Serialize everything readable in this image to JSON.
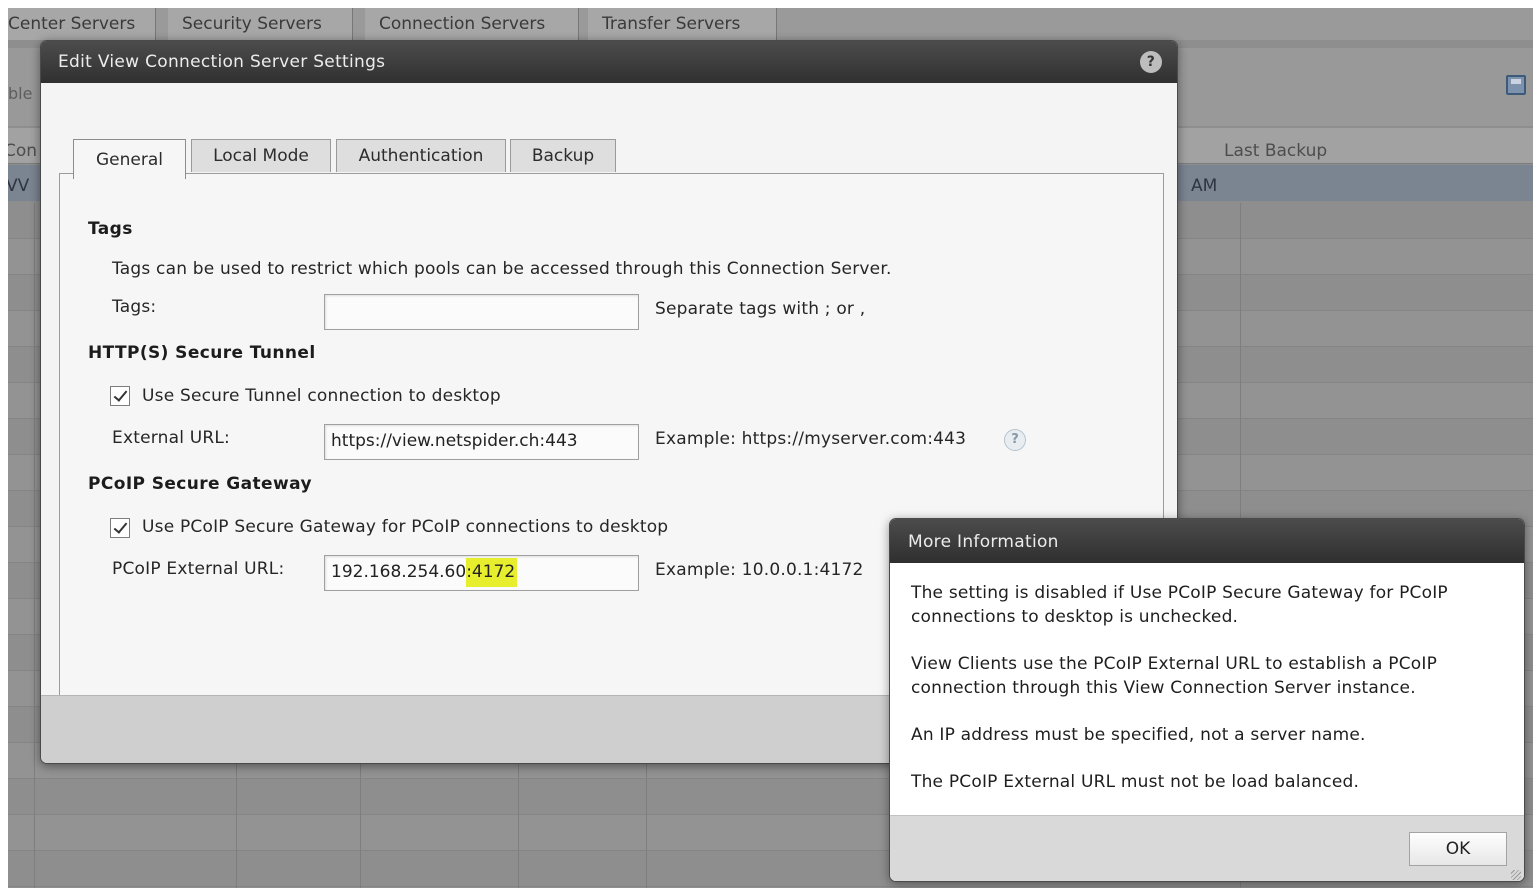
{
  "background": {
    "tabs": [
      "Center Servers",
      "Security Servers",
      "Connection Servers",
      "Transfer Servers"
    ],
    "toolbar_partial_label": "ble",
    "column_header_partial": "Con",
    "last_backup_header": "Last Backup",
    "selected_row_partial": "VV",
    "selected_row_time": "AM"
  },
  "dialog": {
    "title": "Edit View Connection Server Settings",
    "help_glyph": "?",
    "tabs": [
      "General",
      "Local Mode",
      "Authentication",
      "Backup"
    ],
    "tags": {
      "section_title": "Tags",
      "description": "Tags can be used to restrict which pools can be accessed through this Connection Server.",
      "label": "Tags:",
      "value": "",
      "hint": "Separate tags with ; or ,"
    },
    "secure_tunnel": {
      "section_title": "HTTP(S) Secure Tunnel",
      "checkbox_label": "Use Secure Tunnel connection to desktop",
      "checked": true,
      "url_label": "External URL:",
      "url_value": "https://view.netspider.ch:443",
      "example": "Example: https://myserver.com:443",
      "help_glyph": "?"
    },
    "pcoip": {
      "section_title": "PCoIP Secure Gateway",
      "checkbox_label": "Use PCoIP Secure Gateway for PCoIP connections to desktop",
      "checked": true,
      "url_label": "PCoIP External URL:",
      "url_host": "192.168.254.60",
      "url_port": ":4172",
      "example": "Example: 10.0.0.1:4172"
    }
  },
  "info_popup": {
    "title": "More Information",
    "paragraphs": [
      "The setting is disabled if Use PCoIP Secure Gateway for PCoIP connections to desktop is unchecked.",
      "View Clients use the PCoIP External URL to establish a PCoIP connection through this View Connection Server instance.",
      "An IP address must be specified, not a server name.",
      "The PCoIP External URL must not be load balanced."
    ],
    "ok_label": "OK"
  },
  "colors": {
    "highlight": "#e7ee2e",
    "titlebar": "#3a3a3a",
    "selected_row": "#7b8491"
  }
}
